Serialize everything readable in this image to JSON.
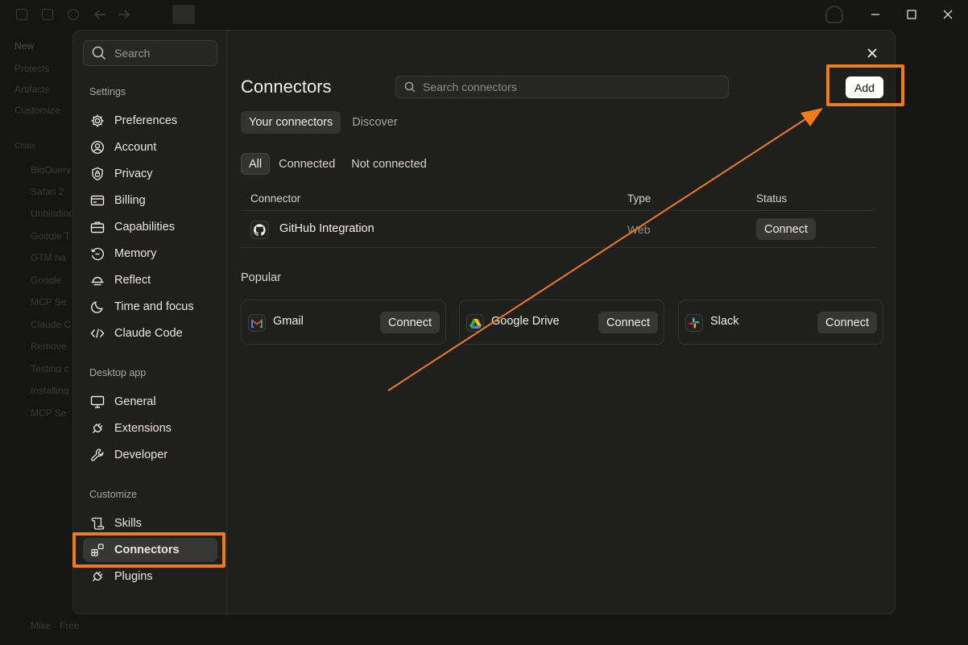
{
  "background": {
    "sidebar_items": [
      "New",
      "Projects",
      "Artifacts",
      "Customize",
      "Chats",
      "BigQuery",
      "Safari 2",
      "Unbinding",
      "Google T",
      "GTM ha",
      "Google",
      "MCP Se",
      "Claude C",
      "Remove",
      "Testing c",
      "Installing",
      "MCP Se"
    ],
    "user": "Mike · Free"
  },
  "settings_search_placeholder": "Search",
  "sections": {
    "settings": "Settings",
    "desktop": "Desktop app",
    "customize": "Customize"
  },
  "nav": {
    "preferences": "Preferences",
    "account": "Account",
    "privacy": "Privacy",
    "billing": "Billing",
    "capabilities": "Capabilities",
    "memory": "Memory",
    "reflect": "Reflect",
    "time_focus": "Time and focus",
    "claude_code": "Claude Code",
    "general": "General",
    "extensions": "Extensions",
    "developer": "Developer",
    "skills": "Skills",
    "connectors": "Connectors",
    "plugins": "Plugins"
  },
  "main": {
    "title": "Connectors",
    "search_placeholder": "Search connectors",
    "add_label": "Add",
    "tabs": [
      "Your connectors",
      "Discover"
    ],
    "filters": [
      "All",
      "Connected",
      "Not connected"
    ],
    "columns": {
      "connector": "Connector",
      "type": "Type",
      "status": "Status"
    },
    "row": {
      "name": "GitHub Integration",
      "type": "Web",
      "action": "Connect"
    },
    "popular_label": "Popular",
    "popular": [
      {
        "name": "Gmail",
        "action": "Connect"
      },
      {
        "name": "Google Drive",
        "action": "Connect"
      },
      {
        "name": "Slack",
        "action": "Connect"
      }
    ]
  },
  "colors": {
    "highlight": "#f07b1d",
    "modal_bg": "#1f1f1e",
    "active_item": "#363634"
  }
}
